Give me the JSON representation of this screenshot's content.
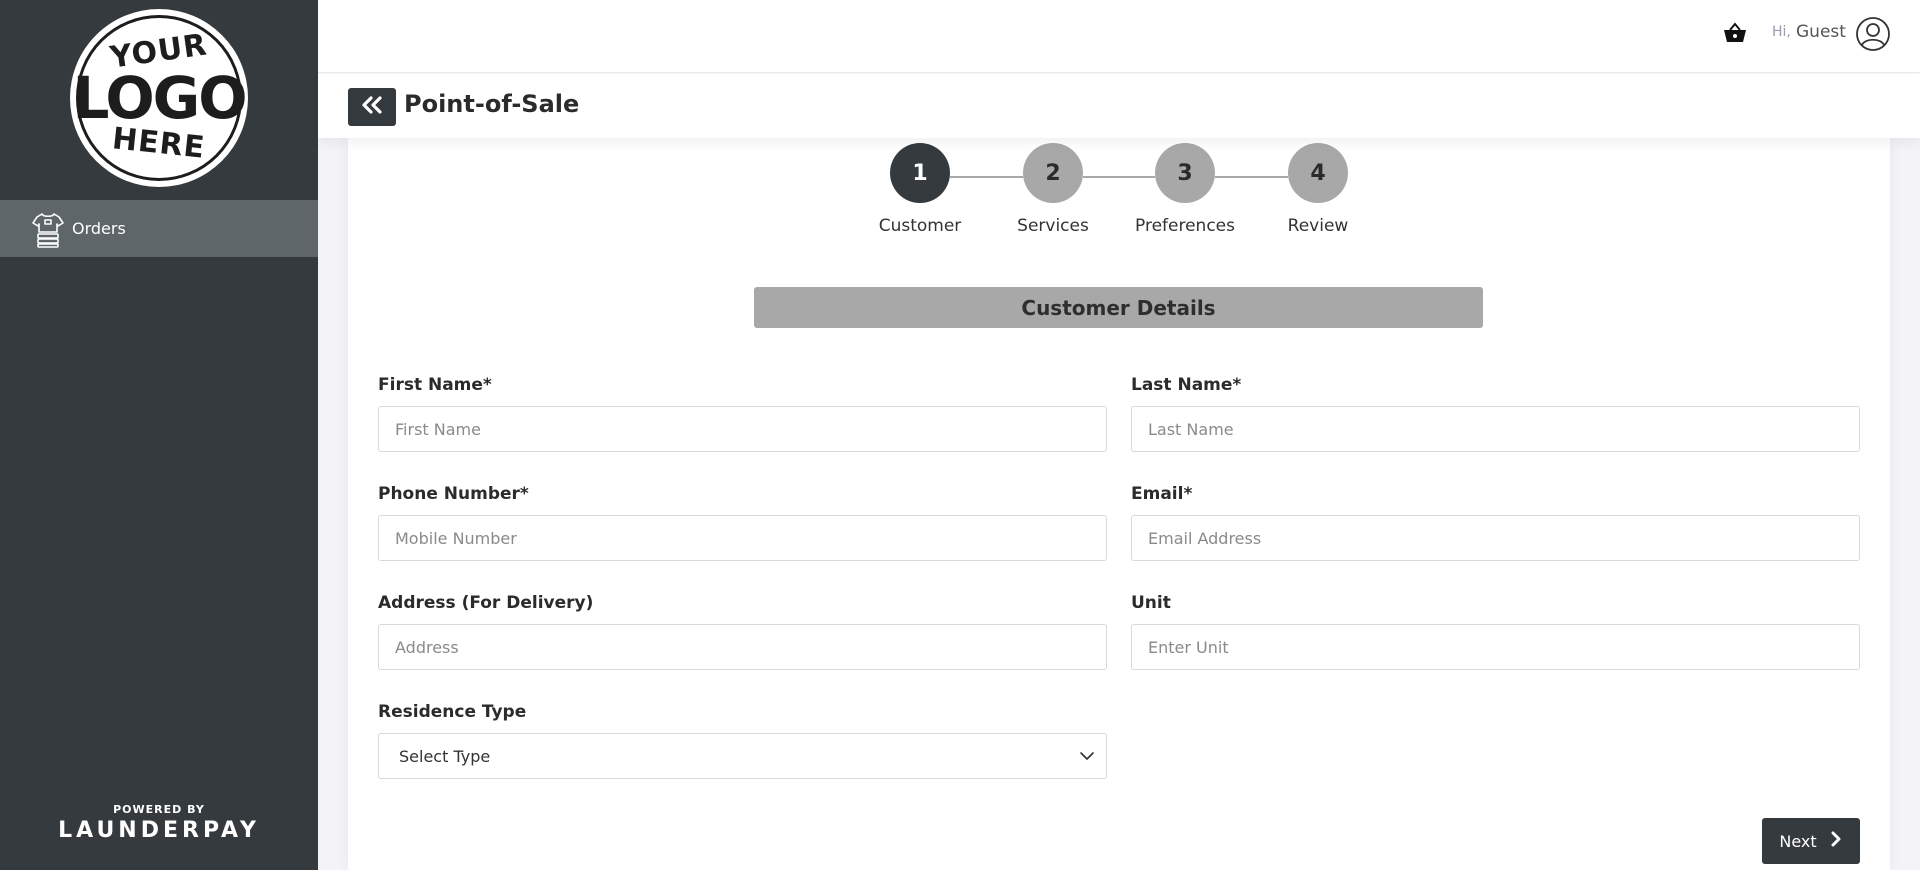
{
  "sidebar": {
    "logo": {
      "line1": "YOUR",
      "line2": "LOGO",
      "line3": "HERE"
    },
    "items": [
      {
        "label": "Orders",
        "icon": "shirt-icon"
      }
    ],
    "powered_by": {
      "line1": "POWERED BY",
      "line2": "LAUNDERPAY"
    }
  },
  "topbar": {
    "greeting": "Hi,",
    "username": "Guest",
    "icons": [
      "basket-icon",
      "user-icon"
    ]
  },
  "page": {
    "title": "Point-of-Sale",
    "back_icon": "double-chevron-left-icon"
  },
  "stepper": {
    "steps": [
      {
        "number": "1",
        "label": "Customer",
        "active": true
      },
      {
        "number": "2",
        "label": "Services",
        "active": false
      },
      {
        "number": "3",
        "label": "Preferences",
        "active": false
      },
      {
        "number": "4",
        "label": "Review",
        "active": false
      }
    ]
  },
  "form": {
    "section_title": "Customer Details",
    "first_name": {
      "label": "First Name*",
      "placeholder": "First Name",
      "value": ""
    },
    "last_name": {
      "label": "Last Name*",
      "placeholder": "Last Name",
      "value": ""
    },
    "phone": {
      "label": "Phone Number*",
      "placeholder": "Mobile Number",
      "value": ""
    },
    "email": {
      "label": "Email*",
      "placeholder": "Email Address",
      "value": ""
    },
    "address": {
      "label": "Address (For Delivery)",
      "placeholder": "Address",
      "value": ""
    },
    "unit": {
      "label": "Unit",
      "placeholder": "Enter Unit",
      "value": ""
    },
    "residence_type": {
      "label": "Residence Type",
      "selected": "Select Type"
    },
    "next_label": "Next"
  },
  "colors": {
    "sidebar_bg": "#343a3e",
    "nav_active_bg": "#5f6669",
    "step_active": "#343a3e",
    "step_inactive": "#a8a8a8"
  }
}
